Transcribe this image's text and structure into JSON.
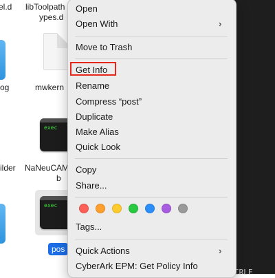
{
  "finder": {
    "labels": {
      "top_left": "el.d",
      "top_mid_line1": "libToolpath",
      "top_mid_line2": "ypes.d",
      "mid_left": "og",
      "mid_mid": "mwkern",
      "row3_left": "ilder",
      "row3_mid_line1": "NaNeuCAM",
      "row3_mid_line2": "b",
      "selected": "pos"
    },
    "exec_text": "exec",
    "selection_color": "#1b6ee6"
  },
  "status_bar": {
    "text": "CRLF"
  },
  "menu": {
    "items": {
      "open": "Open",
      "open_with": "Open With",
      "move_to_trash": "Move to Trash",
      "get_info": "Get Info",
      "rename": "Rename",
      "compress": "Compress “post”",
      "duplicate": "Duplicate",
      "make_alias": "Make Alias",
      "quick_look": "Quick Look",
      "copy": "Copy",
      "share": "Share...",
      "tags": "Tags...",
      "quick_actions": "Quick Actions",
      "cyberark": "CyberArk EPM: Get Policy Info"
    },
    "submenu_chevron": "›",
    "highlight_color": "#e8261e",
    "tag_colors": [
      "#fe5f57",
      "#fe9f2e",
      "#fecb2f",
      "#28c840",
      "#2c8ef8",
      "#a75be0",
      "#9a9a9a"
    ]
  }
}
